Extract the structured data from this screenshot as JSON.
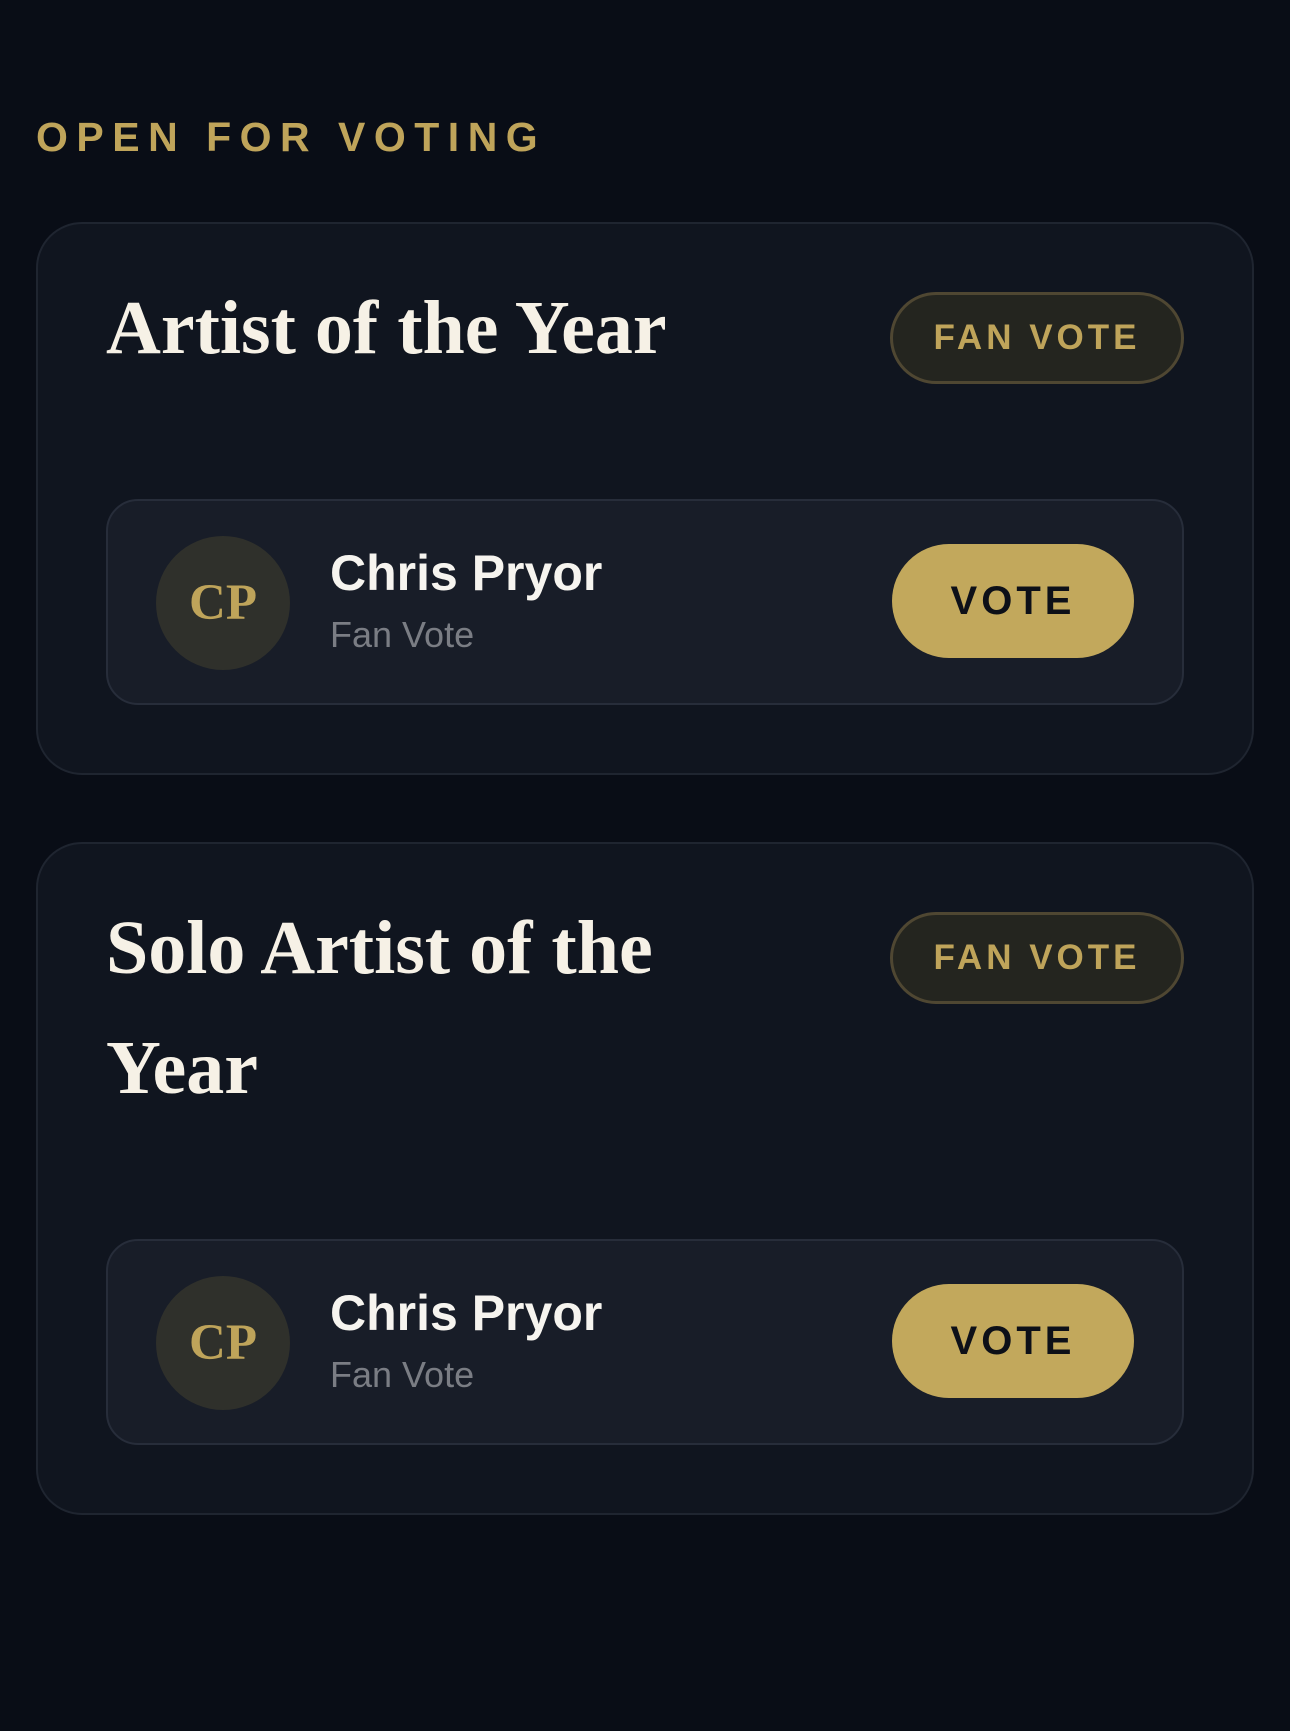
{
  "section": {
    "heading": "OPEN FOR VOTING"
  },
  "categories": [
    {
      "title": "Artist of the Year",
      "badge": "FAN VOTE",
      "nominees": [
        {
          "initials": "CP",
          "name": "Chris Pryor",
          "subtitle": "Fan Vote",
          "vote_label": "VOTE"
        }
      ]
    },
    {
      "title": "Solo Artist of the Year",
      "badge": "FAN VOTE",
      "nominees": [
        {
          "initials": "CP",
          "name": "Chris Pryor",
          "subtitle": "Fan Vote",
          "vote_label": "VOTE"
        }
      ]
    }
  ],
  "colors": {
    "background": "#090d16",
    "accent_gold": "#bfa45a",
    "button_gold": "#c2a85c",
    "card": "#10151f",
    "nominee_row": "#181d28",
    "title_text": "#f6f1e6"
  }
}
